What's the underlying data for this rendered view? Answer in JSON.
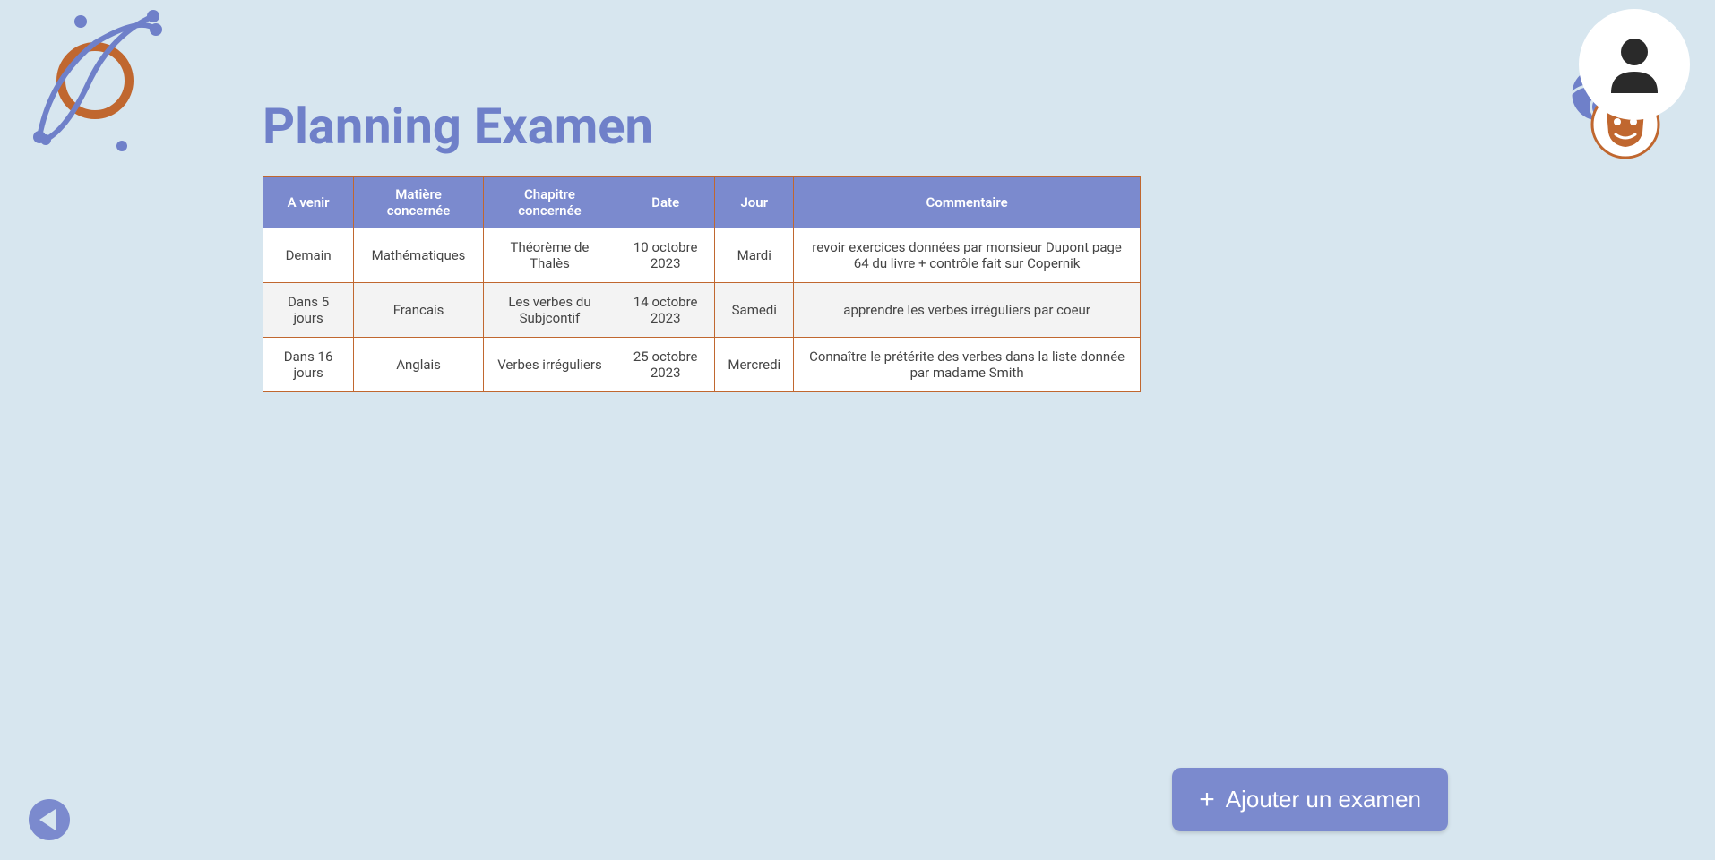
{
  "page": {
    "title": "Planning Examen"
  },
  "table": {
    "headers": {
      "upcoming": "A venir",
      "subject": "Matière concernée",
      "chapter": "Chapitre concernée",
      "date": "Date",
      "day": "Jour",
      "comment": "Commentaire"
    },
    "rows": [
      {
        "upcoming": "Demain",
        "subject": "Mathématiques",
        "chapter": "Théorème de Thalès",
        "date": "10 octobre 2023",
        "day": "Mardi",
        "comment": "revoir exercices données par monsieur Dupont page 64 du livre + contrôle fait sur Copernik"
      },
      {
        "upcoming": "Dans 5 jours",
        "subject": "Francais",
        "chapter": "Les verbes du Subjcontif",
        "date": "14 octobre 2023",
        "day": "Samedi",
        "comment": "apprendre les verbes irréguliers par coeur"
      },
      {
        "upcoming": "Dans 16 jours",
        "subject": "Anglais",
        "chapter": "Verbes irréguliers",
        "date": "25 octobre 2023",
        "day": "Mercredi",
        "comment": "Connaître le prétérite des verbes dans la liste donnée par madame Smith"
      }
    ]
  },
  "buttons": {
    "add_exam": "Ajouter un examen"
  },
  "icons": {
    "logo": "orbit-logo",
    "avatar": "user-avatar",
    "ball": "ball-icon",
    "mask": "theater-mask-icon",
    "back": "back-arrow",
    "plus": "+"
  },
  "colors": {
    "background": "#d7e6ef",
    "accent": "#7b8ace",
    "titleColor": "#6f80c9",
    "orange": "#c0672f"
  }
}
